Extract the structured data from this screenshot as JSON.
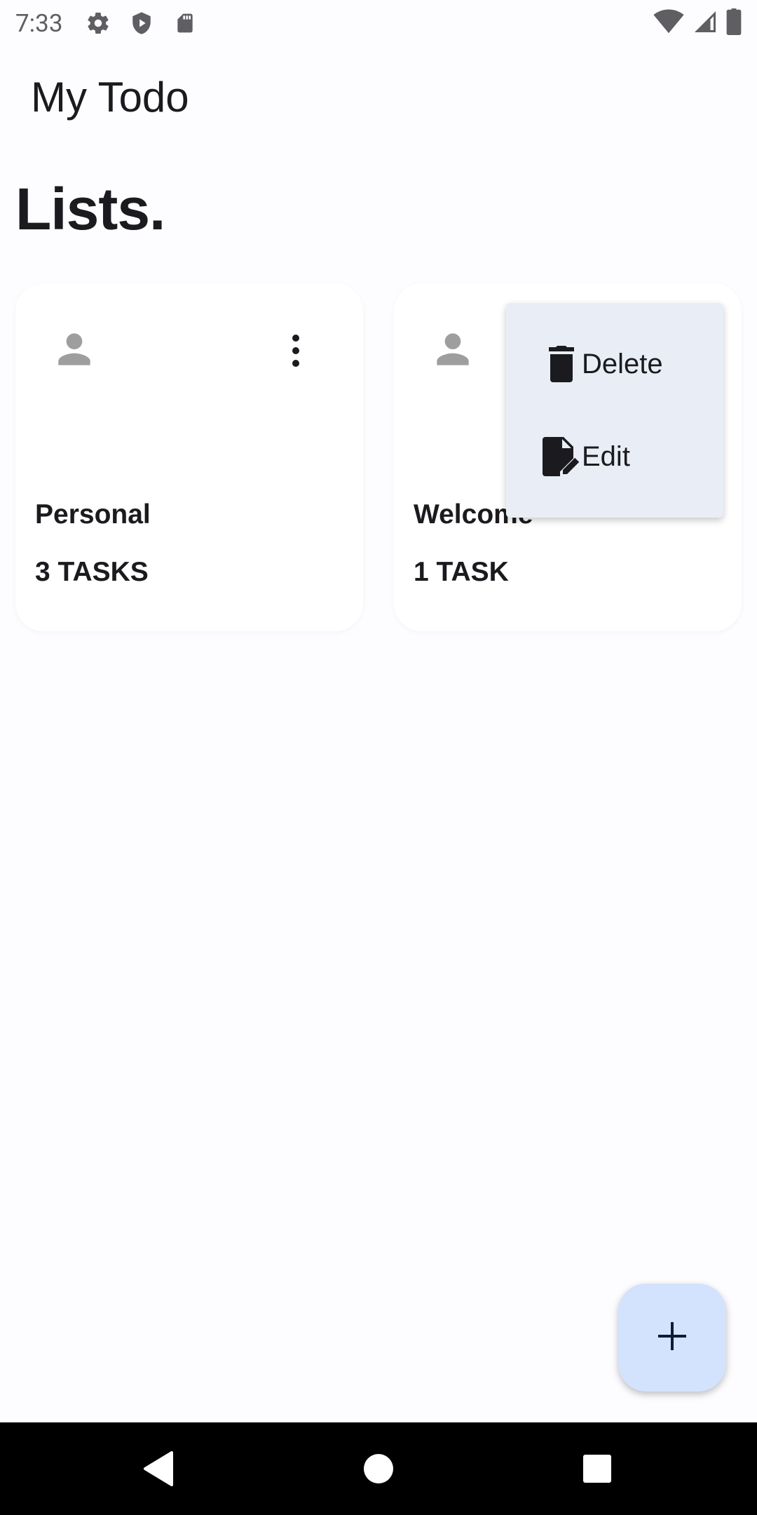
{
  "status_bar": {
    "time": "7:33",
    "left_icons": [
      "gear-icon",
      "shield-icon",
      "sd-card-icon"
    ],
    "right_icons": [
      "wifi-icon",
      "signal-icon",
      "battery-icon"
    ]
  },
  "app": {
    "title": "My Todo"
  },
  "section": {
    "title": "Lists."
  },
  "lists": [
    {
      "name": "Personal",
      "count": "3 TASKS",
      "icon": "person-icon"
    },
    {
      "name": "Welcome",
      "count": "1 TASK",
      "icon": "person-icon"
    }
  ],
  "context_menu": {
    "items": [
      {
        "label": "Delete",
        "icon": "trash-icon"
      },
      {
        "label": "Edit",
        "icon": "edit-document-icon"
      }
    ]
  },
  "fab": {
    "icon": "plus-icon"
  },
  "nav": {
    "buttons": [
      "back-icon",
      "home-icon",
      "recents-icon"
    ]
  },
  "colors": {
    "background": "#FDFCFF",
    "card": "#FFFFFF",
    "menu": "#E9EEF6",
    "fab": "#D3E3FD",
    "icon_gray": "#9E9E9E"
  }
}
